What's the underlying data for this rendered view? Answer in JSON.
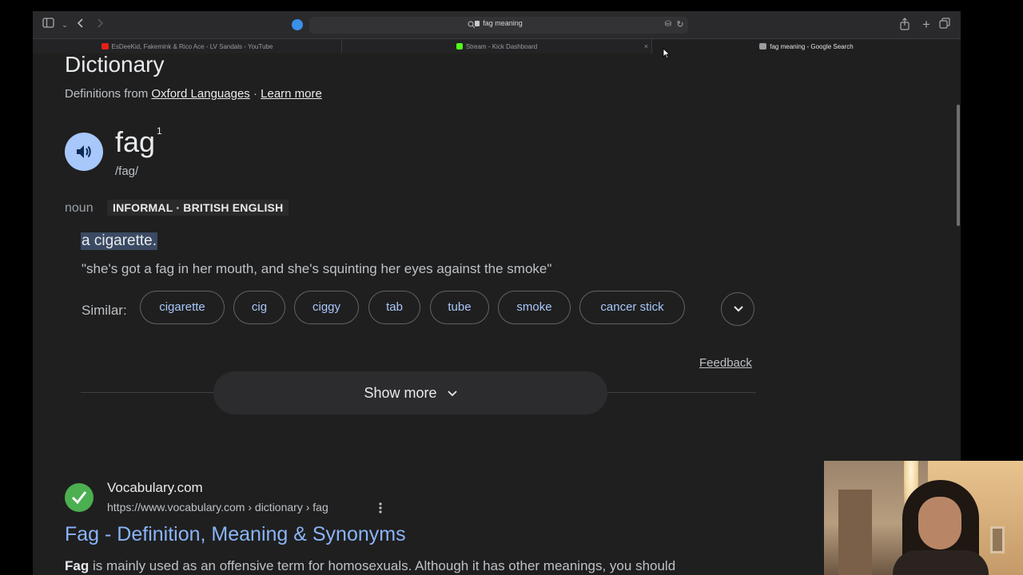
{
  "browser": {
    "address": "fag meaning",
    "tabs": [
      {
        "label": "EsDeeKid, Fakemink & Rico Ace - LV Sandals - YouTube",
        "favicon_color": "#e62117"
      },
      {
        "label": "Stream - Kick Dashboard",
        "favicon_color": "#53fc18"
      },
      {
        "label": "fag meaning - Google Search",
        "favicon_color": "#9a9aa0"
      }
    ]
  },
  "dictionary": {
    "heading": "Dictionary",
    "source_prefix": "Definitions from",
    "source_link": "Oxford Languages",
    "separator": "·",
    "learn_more": "Learn more",
    "word": "fag",
    "superscript": "1",
    "phonetic": "/fag/",
    "part_of_speech": "noun",
    "register": "INFORMAL · BRITISH ENGLISH",
    "definition": "a cigarette.",
    "example": "\"she's got a fag in her mouth, and she's squinting her eyes against the smoke\"",
    "similar_label": "Similar:",
    "similar": [
      "cigarette",
      "cig",
      "ciggy",
      "tab",
      "tube",
      "smoke",
      "cancer stick"
    ],
    "feedback": "Feedback",
    "show_more": "Show more"
  },
  "result": {
    "site_name": "Vocabulary.com",
    "url": "https://www.vocabulary.com › dictionary › fag",
    "title": "Fag - Definition, Meaning & Synonyms",
    "snippet_bold": "Fag",
    "snippet_rest": " is mainly used as an offensive term for homosexuals. Although it has other meanings, you should"
  },
  "colors": {
    "link": "#8ab4f8",
    "chip_text": "#a8c7fa",
    "highlight": "#3b4a63"
  }
}
